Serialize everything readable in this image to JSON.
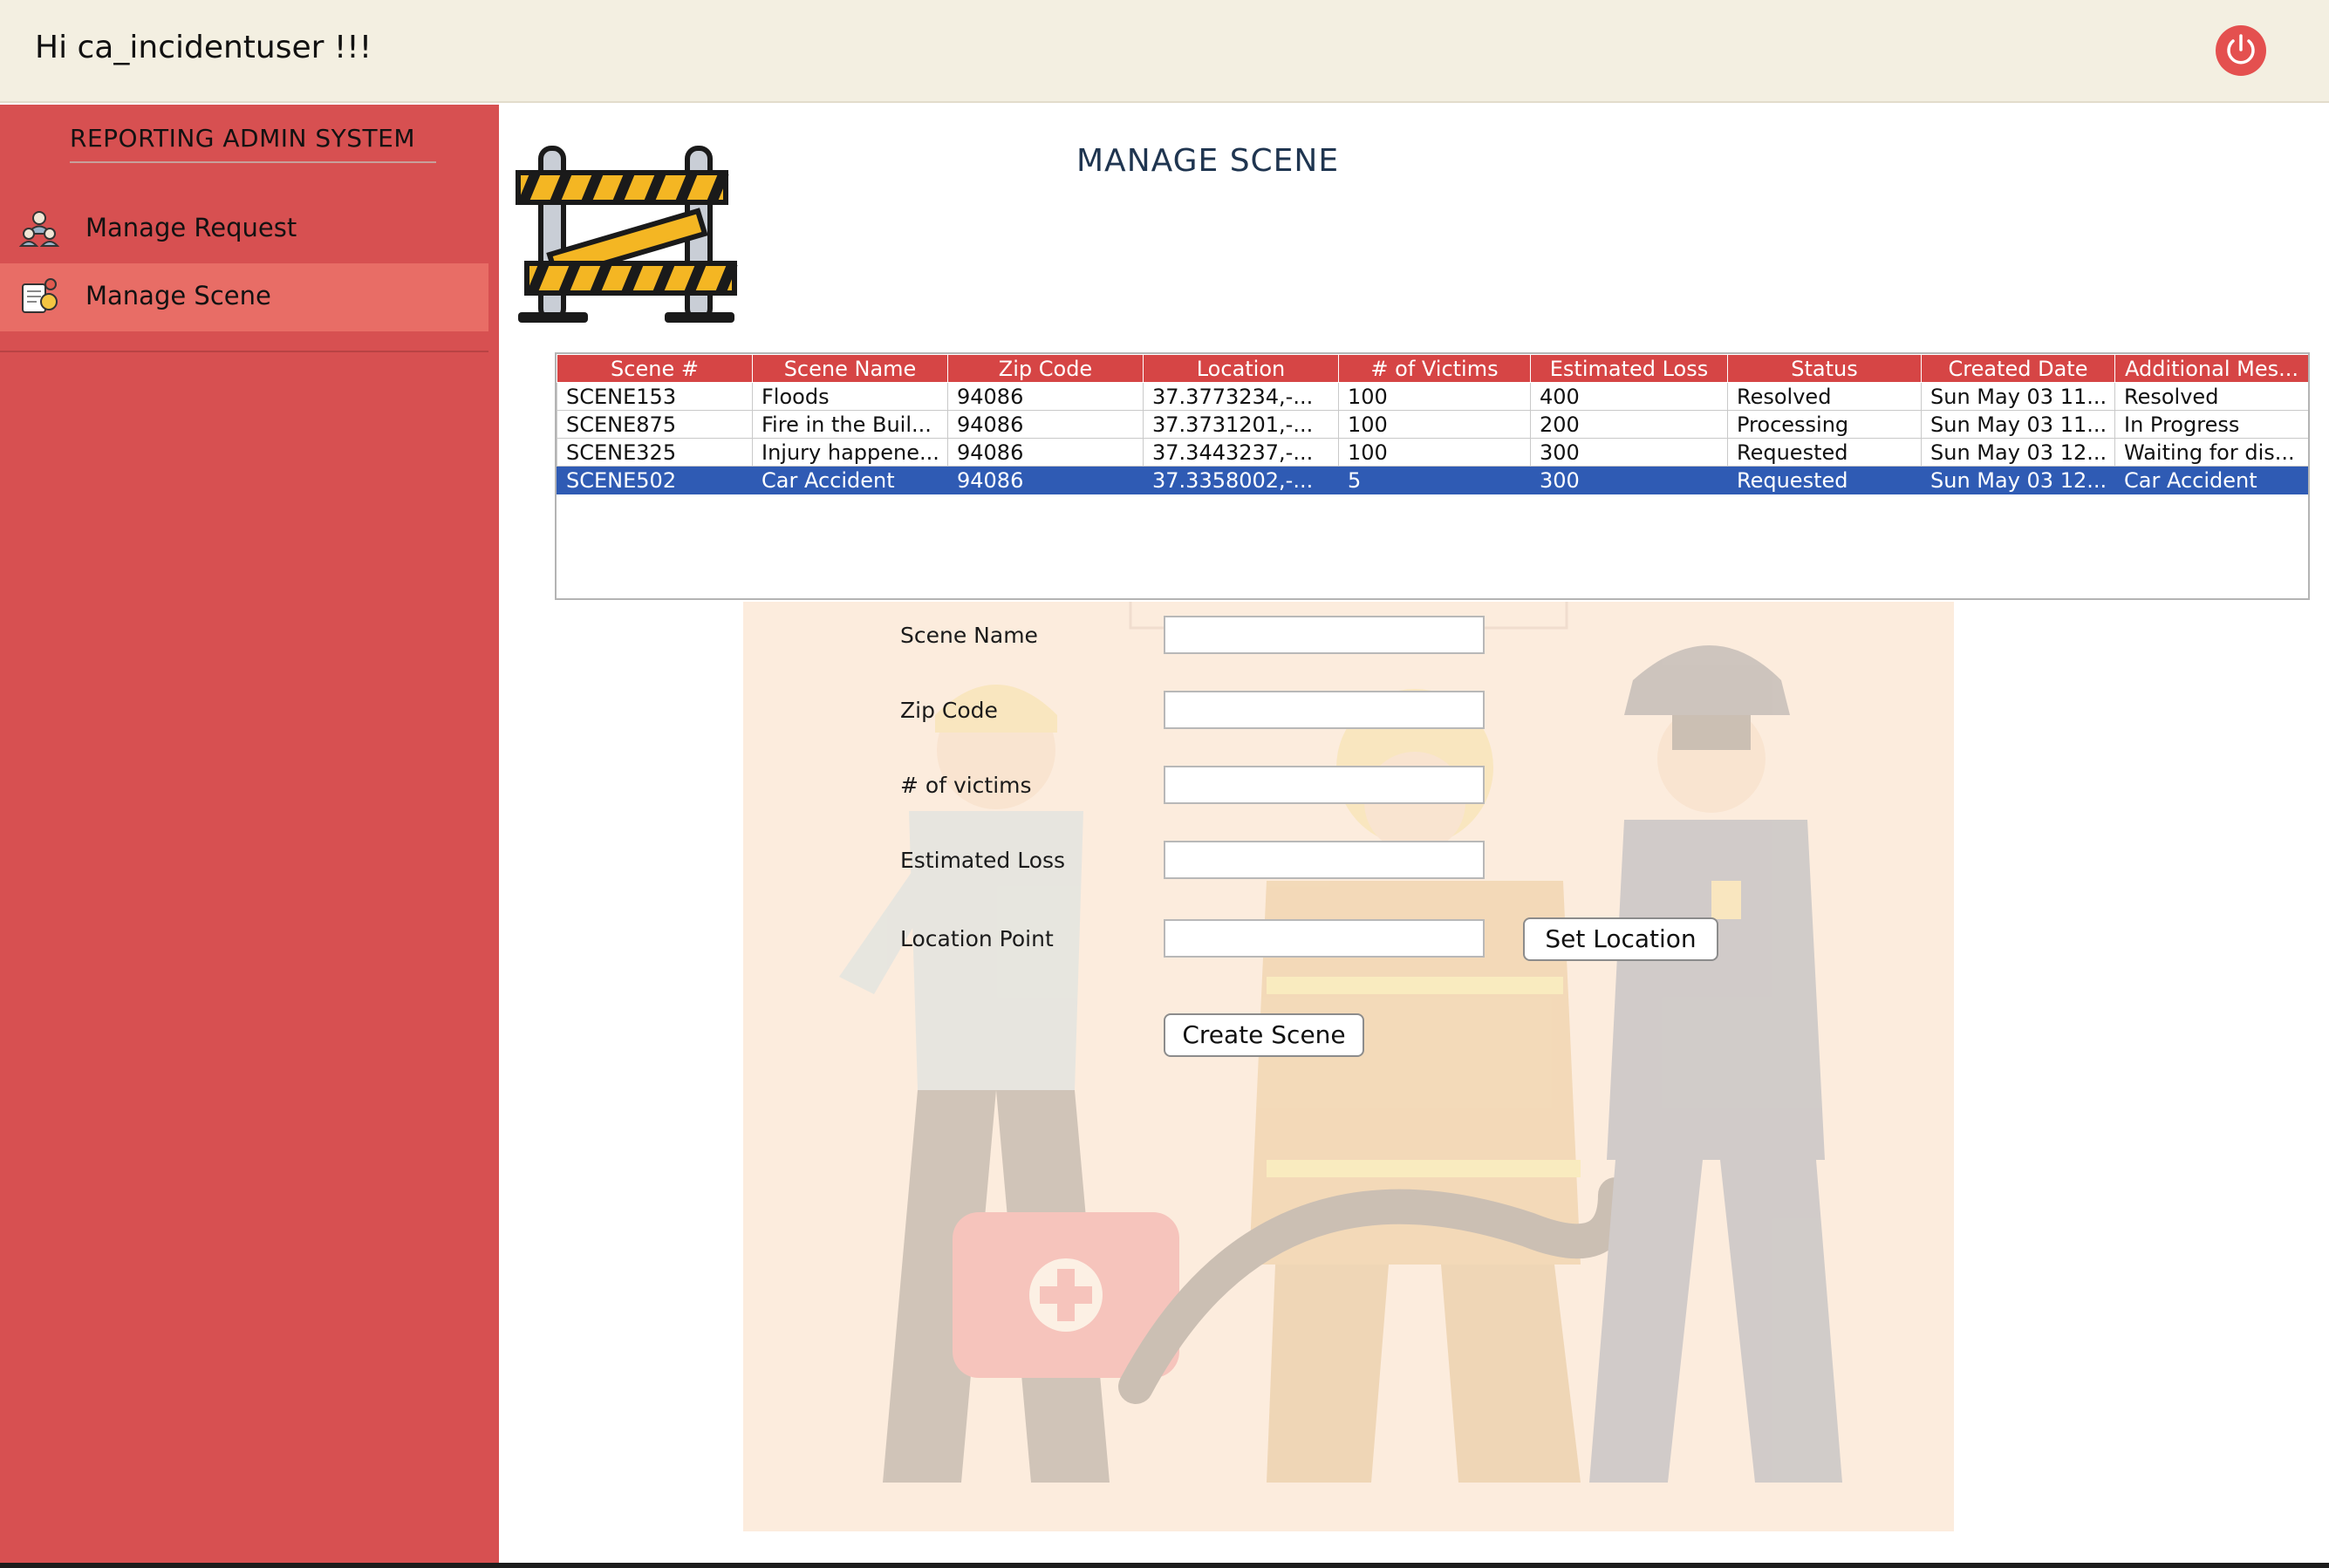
{
  "header": {
    "greeting": "Hi ca_incidentuser !!!"
  },
  "sidebar": {
    "title": "REPORTING ADMIN SYSTEM",
    "items": [
      {
        "label": "Manage Request",
        "active": false
      },
      {
        "label": "Manage Scene",
        "active": true
      }
    ]
  },
  "main": {
    "title": "MANAGE SCENE"
  },
  "table": {
    "columns": [
      "Scene #",
      "Scene Name",
      "Zip Code",
      "Location",
      "# of Victims",
      "Estimated Loss",
      "Status",
      "Created Date",
      "Additional Mes..."
    ],
    "rows": [
      [
        "SCENE153",
        "Floods",
        "94086",
        "37.3773234,-...",
        "100",
        "400",
        "Resolved",
        "Sun May 03 11...",
        "Resolved"
      ],
      [
        "SCENE875",
        "Fire in the Buil...",
        "94086",
        "37.3731201,-...",
        "100",
        "200",
        "Processing",
        "Sun May 03 11...",
        "In Progress"
      ],
      [
        "SCENE325",
        "Injury happene...",
        "94086",
        "37.3443237,-...",
        "100",
        "300",
        "Requested",
        "Sun May 03 12...",
        "Waiting for dis..."
      ],
      [
        "SCENE502",
        "Car Accident",
        "94086",
        "37.3358002,-...",
        "5",
        "300",
        "Requested",
        "Sun May 03 12...",
        "Car Accident"
      ]
    ],
    "selected_row": 3
  },
  "form": {
    "scene_name_label": "Scene Name",
    "zip_code_label": "Zip Code",
    "victims_label": "# of victims",
    "estimated_loss_label": "Estimated Loss",
    "location_point_label": "Location Point",
    "scene_name_value": "",
    "zip_code_value": "",
    "victims_value": "",
    "estimated_loss_value": "",
    "location_point_value": "",
    "set_location_label": "Set Location",
    "create_scene_label": "Create Scene"
  },
  "colors": {
    "sidebar": "#d75051",
    "sidebar_active": "#e86d66",
    "header": "#f3efe1",
    "table_header": "#d64545",
    "selected_row": "#2f5bb4",
    "power": "#e4504f",
    "title": "#1f3550"
  },
  "icons": {
    "power": "power-icon",
    "manage_request": "people-group-icon",
    "manage_scene": "scene-doc-icon",
    "barrier": "road-barrier-icon"
  }
}
